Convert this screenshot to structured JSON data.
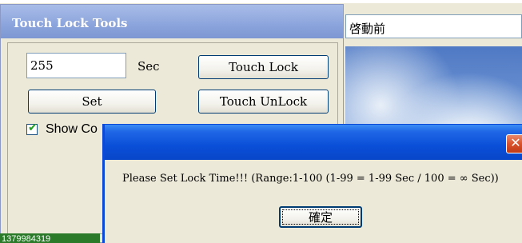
{
  "background": {
    "top_text": "啓動前",
    "field_text": "啓動前"
  },
  "touch_lock_window": {
    "title": "Touch Lock Tools",
    "seconds_value": "255",
    "seconds_unit": "Sec",
    "set_button": "Set",
    "touch_lock_button": "Touch Lock",
    "touch_unlock_button": "Touch UnLock",
    "show_checkbox_label": "Show Co",
    "show_checked": true
  },
  "taskbar": {
    "text": "1379984319"
  },
  "message_dialog": {
    "message": "Please Set Lock Time!!! (Range:1-100 (1-99 = 1-99 Sec / 100 = ∞ Sec))",
    "ok_button": "確定",
    "close_glyph": "✕"
  },
  "colors": {
    "dialog_title": "#0a4fd8",
    "tool_title": "#8ba4dc",
    "close_button": "#d8532b"
  }
}
